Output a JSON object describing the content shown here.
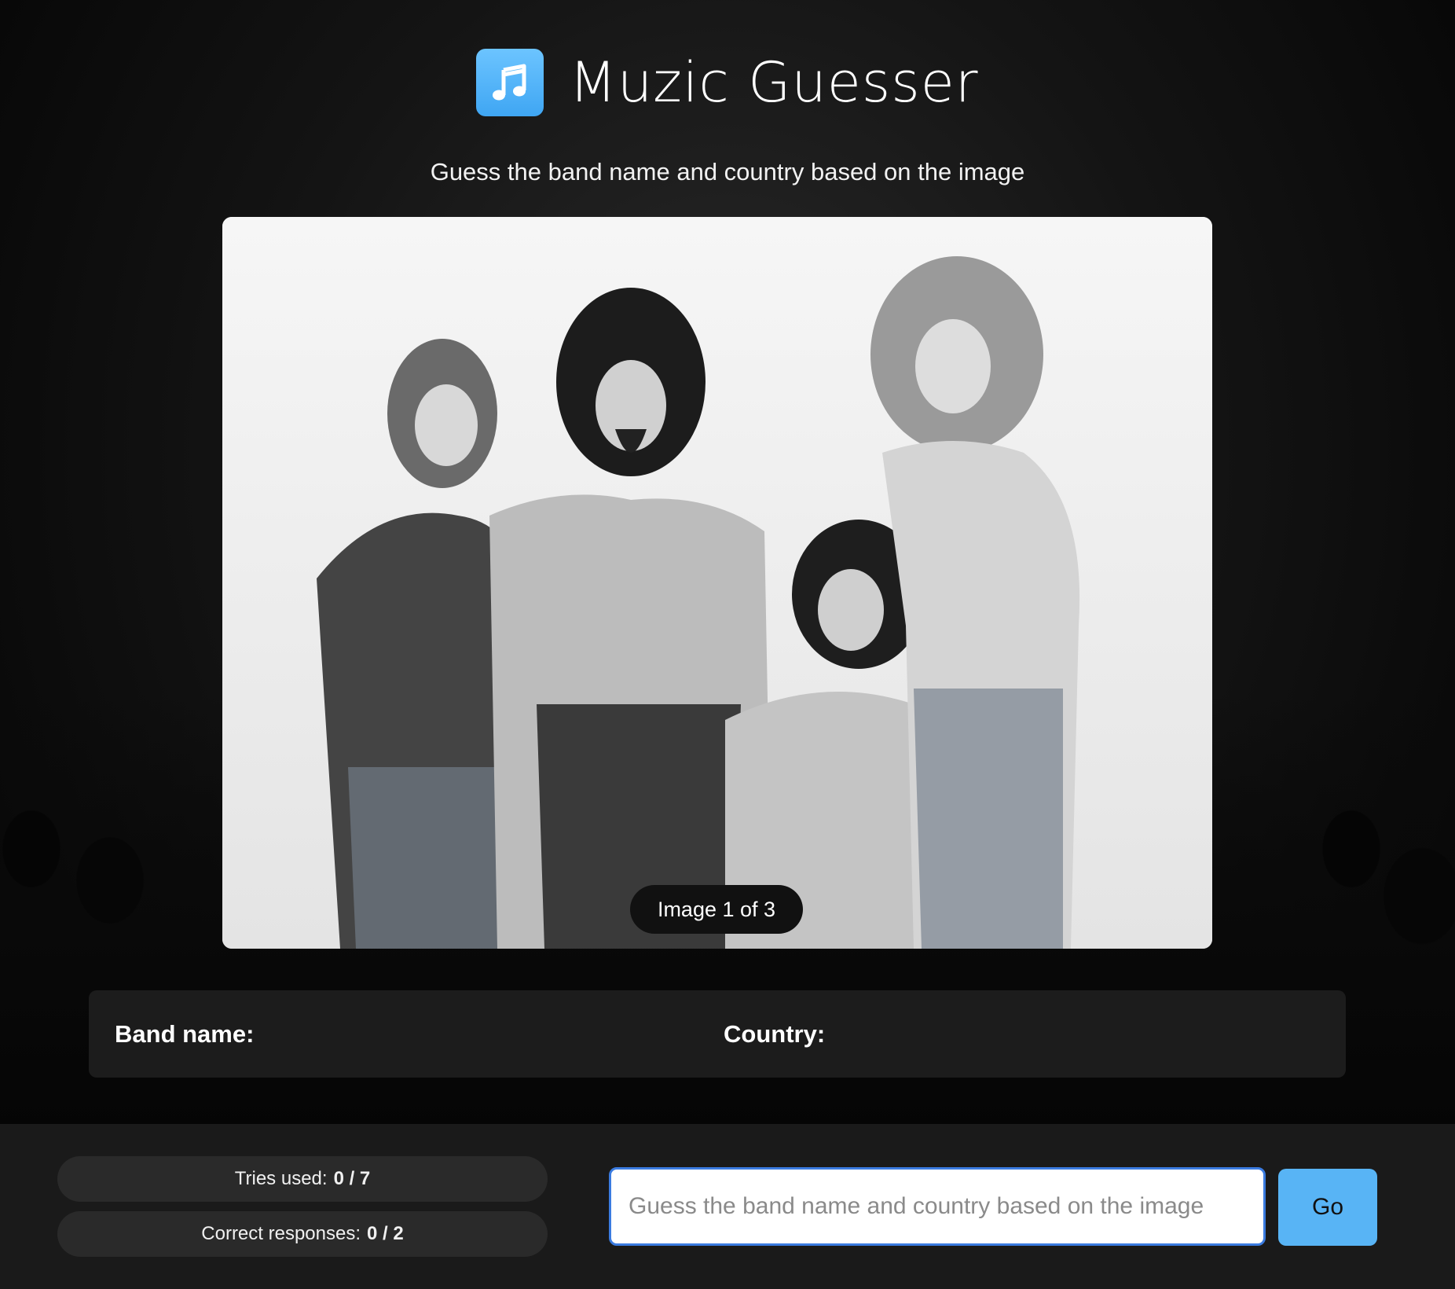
{
  "header": {
    "title": "Muzic Guesser",
    "logo_icon": "music-note-icon",
    "accent_color": "#4fb0f7"
  },
  "subtitle": "Guess the band name and country based on the image",
  "image_viewer": {
    "counter_text": "Image 1 of 3",
    "image_description_icon": "band-photo"
  },
  "answer": {
    "band_label": "Band name:",
    "band_value": "",
    "country_label": "Country:",
    "country_value": ""
  },
  "stats": {
    "tries_label": "Tries used:",
    "tries_value": "0 / 7",
    "correct_label": "Correct responses:",
    "correct_value": "0 / 2"
  },
  "guess": {
    "placeholder": "Guess the band name and country based on the image",
    "value": "",
    "button_label": "Go"
  }
}
